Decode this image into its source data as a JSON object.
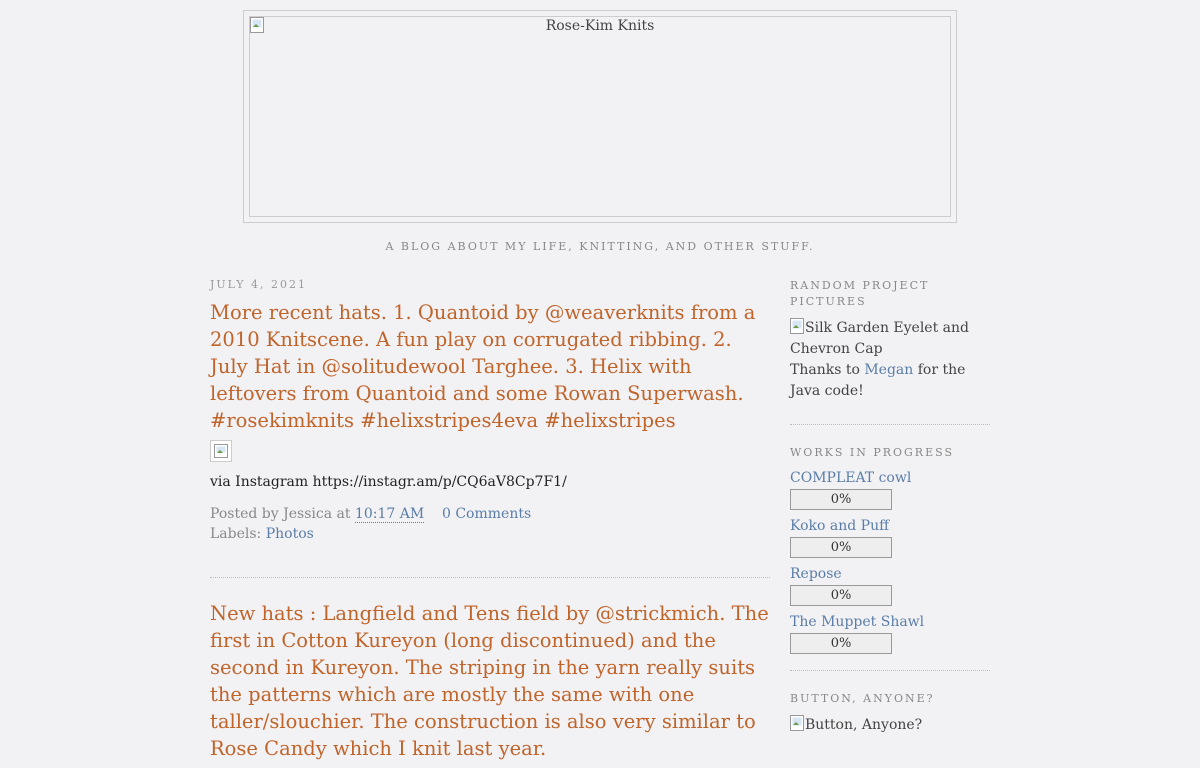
{
  "header": {
    "image_alt": "Rose-Kim Knits",
    "tagline": "A blog about my life, knitting, and other stuff."
  },
  "posts": [
    {
      "date": "July 4, 2021",
      "title": "More recent hats. 1. Quantoid by @weaverknits from a 2010 Knitscene. A fun play on corrugated ribbing. 2. July Hat in @solitudewool Targhee. 3. Helix with leftovers from Quantoid and some Rowan Superwash. #rosekimknits #helixstripes4eva #helixstripes",
      "via": "via Instagram https://instagr.am/p/CQ6aV8Cp7F1/",
      "posted_by_prefix": "Posted by Jessica at",
      "time": "10:17 AM",
      "comments": "0 Comments",
      "labels_prefix": "Labels:",
      "label": "Photos"
    },
    {
      "title": "New hats : Langfield and Tens field by @strickmich. The first in Cotton Kureyon (long discontinued) and the second in Kureyon. The striping in the yarn really suits the patterns which are mostly the same with one taller/slouchier. The construction is also very similar to Rose Candy which I knit last year."
    }
  ],
  "sidebar": {
    "random": {
      "heading": "Random Project Pictures",
      "image_alt": "Silk Garden Eyelet and Chevron Cap",
      "thanks_prefix": "Thanks to",
      "thanks_link": "Megan",
      "thanks_suffix": "for the Java code!"
    },
    "wip": {
      "heading": "Works in Progress",
      "items": [
        {
          "name": "COMPLEAT cowl",
          "progress": "0%"
        },
        {
          "name": "Koko and Puff",
          "progress": "0%"
        },
        {
          "name": "Repose",
          "progress": "0%"
        },
        {
          "name": "The Muppet Shawl",
          "progress": "0%"
        }
      ]
    },
    "button": {
      "heading": "Button, Anyone?",
      "image_alt": "Button, Anyone?"
    }
  }
}
